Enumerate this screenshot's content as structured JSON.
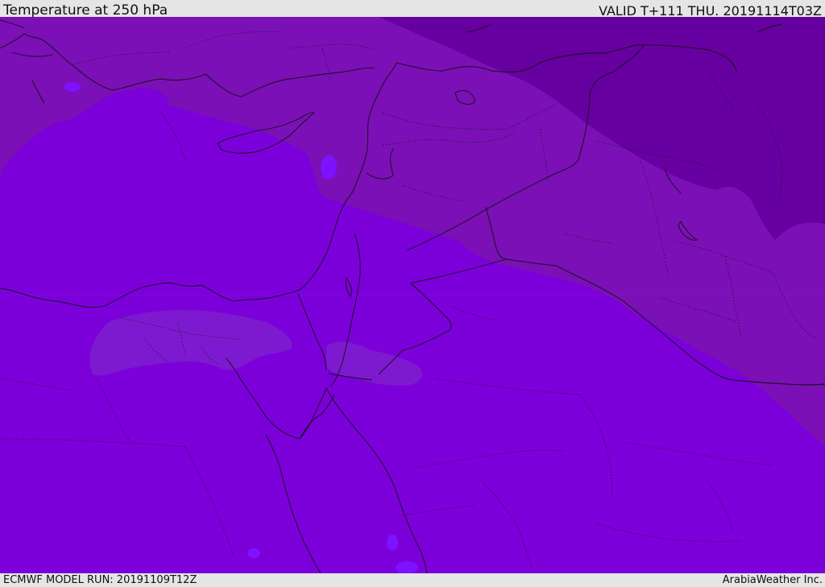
{
  "header": {
    "title": "Temperature at 250 hPa",
    "valid": "VALID T+111 THU. 20191114T03Z"
  },
  "footer": {
    "model_run": "ECMWF MODEL RUN: 20191109T12Z",
    "credit": "ArabiaWeather Inc."
  },
  "map": {
    "field": "temperature",
    "level": "250 hPa",
    "colors": {
      "coldest": "#6600a0",
      "cold": "#7b10b8",
      "base": "#7b00d9",
      "warm_patch": "#7d1ad0",
      "warmest": "#7e12ff",
      "border": "#111111"
    }
  }
}
